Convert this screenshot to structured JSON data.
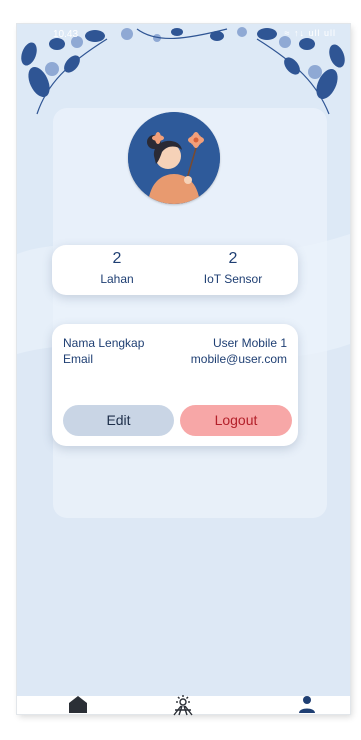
{
  "status_bar": {
    "time": "10.43",
    "icons_text": "≈ ↑↓ ull ull"
  },
  "stats": [
    {
      "value": "2",
      "label": "Lahan"
    },
    {
      "value": "2",
      "label": "IoT Sensor"
    }
  ],
  "profile": {
    "fields": [
      {
        "key": "Nama Lengkap",
        "value": "User Mobile 1"
      },
      {
        "key": "Email",
        "value": "mobile@user.com"
      }
    ]
  },
  "buttons": {
    "edit_label": "Edit",
    "logout_label": "Logout"
  },
  "bottom_nav": {
    "items": [
      "home-icon",
      "sun-field-icon",
      "user-icon"
    ],
    "active": "user-icon"
  },
  "colors": {
    "primary_text": "#1f3f73",
    "edit_button": "#c9d5e5",
    "logout_button": "#f7a7a7",
    "logout_text": "#b3202a",
    "background": "#dde9f6",
    "avatar_bg": "#2e5a9a"
  }
}
